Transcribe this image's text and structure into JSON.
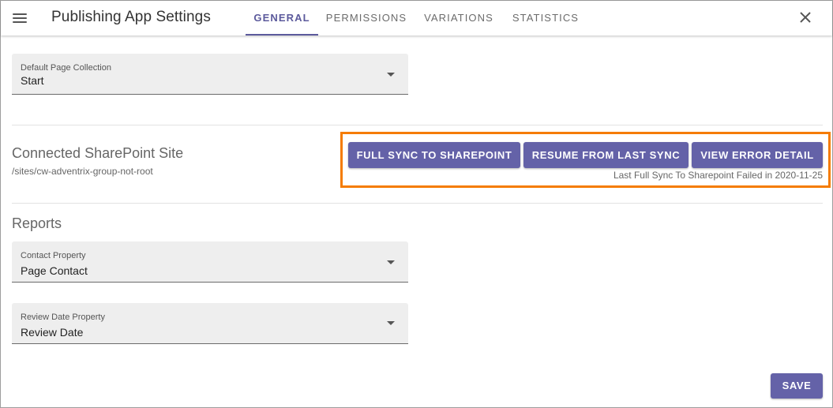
{
  "header": {
    "title": "Publishing App Settings",
    "tabs": [
      {
        "label": "GENERAL",
        "active": true
      },
      {
        "label": "PERMISSIONS",
        "active": false
      },
      {
        "label": "VARIATIONS",
        "active": false
      },
      {
        "label": "STATISTICS",
        "active": false
      }
    ]
  },
  "general": {
    "default_collection": {
      "label": "Default Page Collection",
      "value": "Start"
    }
  },
  "sharepoint": {
    "title": "Connected SharePoint Site",
    "path": "/sites/cw-adventrix-group-not-root",
    "buttons": {
      "full_sync": "FULL SYNC TO SHAREPOINT",
      "resume": "RESUME FROM LAST SYNC",
      "error": "VIEW ERROR DETAIL"
    },
    "status": "Last Full Sync To Sharepoint Failed in 2020-11-25"
  },
  "reports": {
    "title": "Reports",
    "contact": {
      "label": "Contact Property",
      "value": "Page Contact"
    },
    "review": {
      "label": "Review Date Property",
      "value": "Review Date"
    }
  },
  "footer": {
    "save_label": "SAVE"
  },
  "colors": {
    "accent": "#6462a8",
    "highlight": "#f57c00",
    "tab_active": "#5c5a9c"
  },
  "icons": {
    "menu": "menu-icon",
    "close": "close-icon",
    "dropdown": "dropdown-caret-icon"
  }
}
